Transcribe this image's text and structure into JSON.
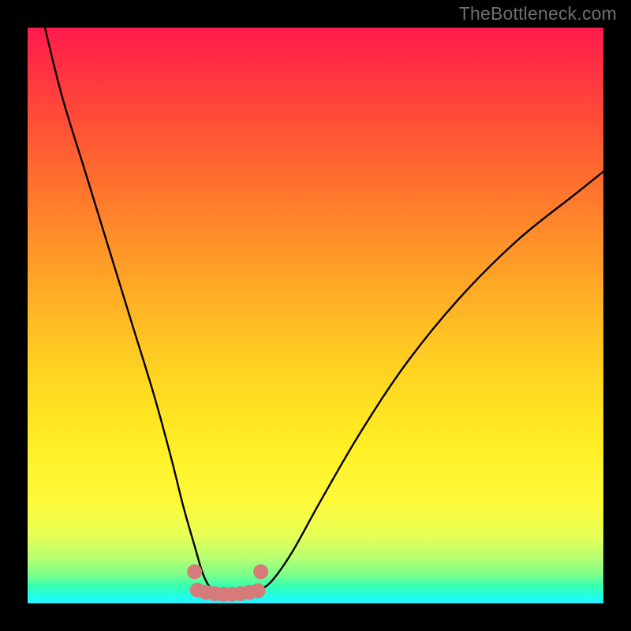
{
  "watermark": "TheBottleneck.com",
  "chart_data": {
    "type": "line",
    "title": "",
    "xlabel": "",
    "ylabel": "",
    "xlim": [
      0,
      100
    ],
    "ylim": [
      0,
      100
    ],
    "series": [
      {
        "name": "bottleneck-curve",
        "x": [
          3,
          6,
          10,
          14,
          18,
          22,
          25,
          27,
          29,
          30.5,
          32,
          34,
          36,
          38,
          40,
          42.5,
          46,
          51,
          58,
          66,
          75,
          85,
          95,
          100
        ],
        "values": [
          100,
          88,
          75,
          62,
          49,
          36,
          25,
          17,
          10,
          5,
          2.5,
          1.8,
          1.6,
          1.7,
          2.2,
          4,
          9,
          18,
          30,
          42,
          53,
          63,
          71,
          75
        ]
      }
    ],
    "markers": {
      "name": "highlight-dots",
      "color": "#d77a7a",
      "x": [
        29.5,
        31,
        32.5,
        34,
        35.5,
        37,
        38.5,
        40,
        29,
        40.5
      ],
      "values": [
        2.3,
        1.9,
        1.7,
        1.6,
        1.6,
        1.7,
        1.9,
        2.2,
        5.5,
        5.5
      ]
    },
    "gradient_meaning": "vertical color gradient from red (high bottleneck) at top to green/cyan (low bottleneck) at bottom"
  }
}
